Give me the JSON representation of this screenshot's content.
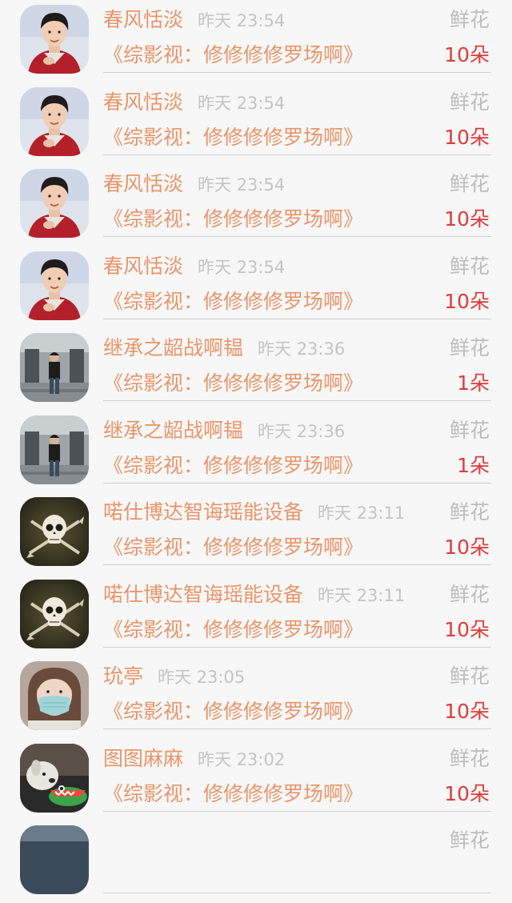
{
  "colors": {
    "accent": "#e8956a",
    "count": "#e03b3b",
    "muted": "#bdbdbd",
    "background": "#f7f7f7"
  },
  "rows": [
    {
      "name": "春风恬淡",
      "time": "昨天 23:54",
      "gift": "鲜花",
      "novel": "《综影视：修修修修罗场啊》",
      "count": "10朵",
      "avatar": "boy-red"
    },
    {
      "name": "春风恬淡",
      "time": "昨天 23:54",
      "gift": "鲜花",
      "novel": "《综影视：修修修修罗场啊》",
      "count": "10朵",
      "avatar": "boy-red"
    },
    {
      "name": "春风恬淡",
      "time": "昨天 23:54",
      "gift": "鲜花",
      "novel": "《综影视：修修修修罗场啊》",
      "count": "10朵",
      "avatar": "boy-red"
    },
    {
      "name": "春风恬淡",
      "time": "昨天 23:54",
      "gift": "鲜花",
      "novel": "《综影视：修修修修罗场啊》",
      "count": "10朵",
      "avatar": "boy-red"
    },
    {
      "name": "继承之龆战啊韫",
      "time": "昨天 23:36",
      "gift": "鲜花",
      "novel": "《综影视：修修修修罗场啊》",
      "count": "1朵",
      "avatar": "man-building"
    },
    {
      "name": "继承之龆战啊韫",
      "time": "昨天 23:36",
      "gift": "鲜花",
      "novel": "《综影视：修修修修罗场啊》",
      "count": "1朵",
      "avatar": "man-building"
    },
    {
      "name": "喏仕博达智诲瑶能设备",
      "time": "昨天 23:11",
      "gift": "鲜花",
      "novel": "《综影视：修修修修罗场啊》",
      "count": "10朵",
      "avatar": "skull"
    },
    {
      "name": "喏仕博达智诲瑶能设备",
      "time": "昨天 23:11",
      "gift": "鲜花",
      "novel": "《综影视：修修修修罗场啊》",
      "count": "10朵",
      "avatar": "skull"
    },
    {
      "name": "玧亭",
      "time": "昨天 23:05",
      "gift": "鲜花",
      "novel": "《综影视：修修修修罗场啊》",
      "count": "10朵",
      "avatar": "girl-mask"
    },
    {
      "name": "图图麻麻",
      "time": "昨天 23:02",
      "gift": "鲜花",
      "novel": "《综影视：修修修修罗场啊》",
      "count": "10朵",
      "avatar": "dog-croc"
    },
    {
      "name": "",
      "time": "",
      "gift": "鲜花",
      "novel": "",
      "count": "",
      "avatar": "partial"
    }
  ]
}
